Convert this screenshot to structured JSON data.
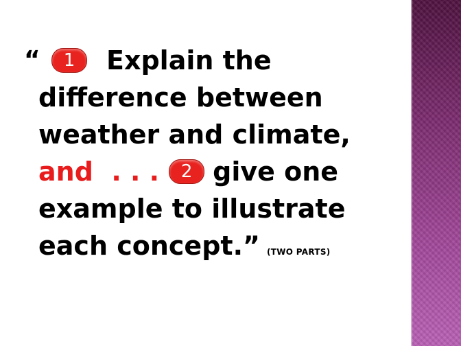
{
  "slide": {
    "quote_open": "“",
    "badge_1": "1",
    "line1_text": "Explain the",
    "line2_text": "difference between",
    "line3_text": "weather and climate,",
    "line4_red": "and  . . .",
    "badge_2": "2",
    "line4_text": "give one",
    "line5_text": "example to illustrate",
    "line6_text": "each concept.”",
    "note": "(TWO PARTS)"
  },
  "colors": {
    "accent_red": "#e81c1c",
    "badge_red": "#e8231f",
    "band_top": "#4f1240",
    "band_bottom": "#b860b4"
  }
}
